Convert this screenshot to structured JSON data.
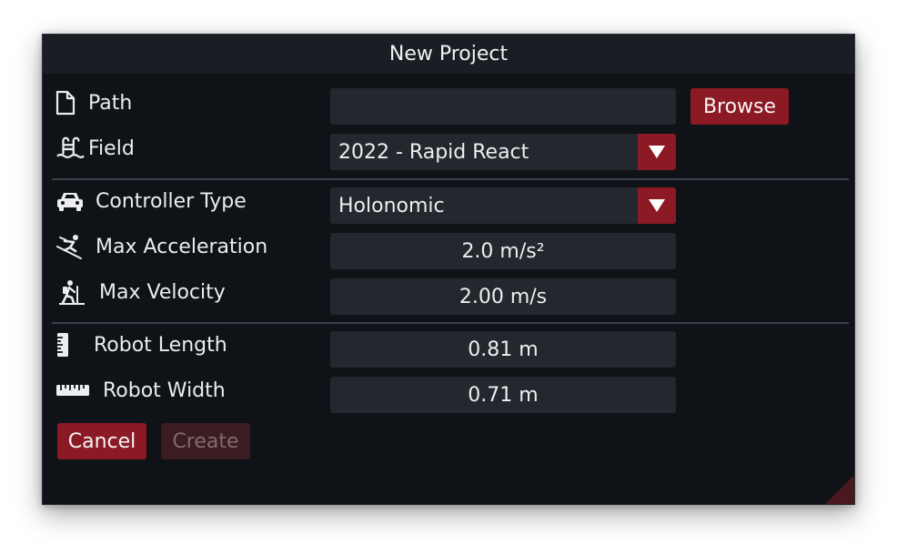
{
  "dialog": {
    "title": "New Project",
    "path": {
      "label": "Path",
      "value": "",
      "browse_label": "Browse"
    },
    "field": {
      "label": "Field",
      "selected": "2022 - Rapid React"
    },
    "controller_type": {
      "label": "Controller Type",
      "selected": "Holonomic"
    },
    "max_acceleration": {
      "label": "Max Acceleration",
      "value": "2.0 m/s²"
    },
    "max_velocity": {
      "label": "Max Velocity",
      "value": "2.00 m/s"
    },
    "robot_length": {
      "label": "Robot Length",
      "value": "0.81 m"
    },
    "robot_width": {
      "label": "Robot Width",
      "value": "0.71 m"
    },
    "cancel_label": "Cancel",
    "create_label": "Create"
  },
  "icons": {
    "path": "file-icon",
    "field": "pool-icon",
    "controller_type": "car-icon",
    "max_acceleration": "skier-icon",
    "max_velocity": "hiker-icon",
    "robot_length": "ruler-vertical-icon",
    "robot_width": "ruler-horizontal-icon"
  },
  "colors": {
    "accent": "#8c1a24",
    "background": "#0f1217",
    "titlebar": "#1a1e24",
    "field_bg": "#23272e",
    "text": "#ecedee"
  }
}
